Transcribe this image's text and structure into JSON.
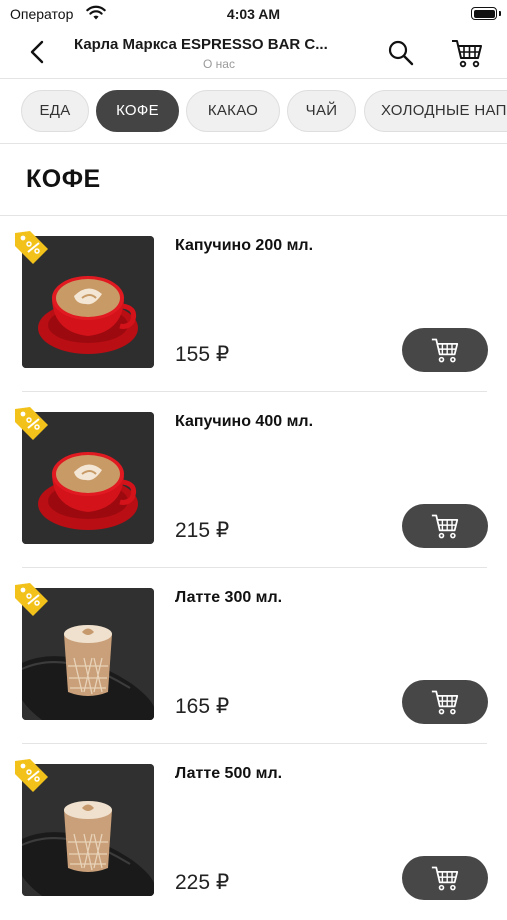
{
  "status_bar": {
    "carrier": "Оператор",
    "time": "4:03 AM"
  },
  "nav": {
    "title": "Карла Маркса ESPRESSO BAR C...",
    "subtitle": "О нас",
    "back_icon": "chevron-left-icon",
    "search_icon": "search-icon",
    "cart_icon": "cart-icon"
  },
  "categories": [
    {
      "label": "ЕДА",
      "active": false
    },
    {
      "label": "КОФЕ",
      "active": true
    },
    {
      "label": "КАКАО",
      "active": false
    },
    {
      "label": "ЧАЙ",
      "active": false
    },
    {
      "label": "ХОЛОДНЫЕ НАПИТКИ",
      "active": false
    }
  ],
  "section": {
    "title": "КОФЕ"
  },
  "products": [
    {
      "name": "Капучино 200 мл.",
      "price": "155 ₽",
      "image": "cappuccino-red-cup"
    },
    {
      "name": "Капучино 400 мл.",
      "price": "215 ₽",
      "image": "cappuccino-red-cup"
    },
    {
      "name": "Латте 300 мл.",
      "price": "165 ₽",
      "image": "latte-glass"
    },
    {
      "name": "Латте 500 мл.",
      "price": "225 ₽",
      "image": "latte-glass"
    }
  ],
  "colors": {
    "accent_dark": "#444444",
    "badge_yellow": "#f2c21b",
    "tab_bg": "#f0f0f0"
  }
}
